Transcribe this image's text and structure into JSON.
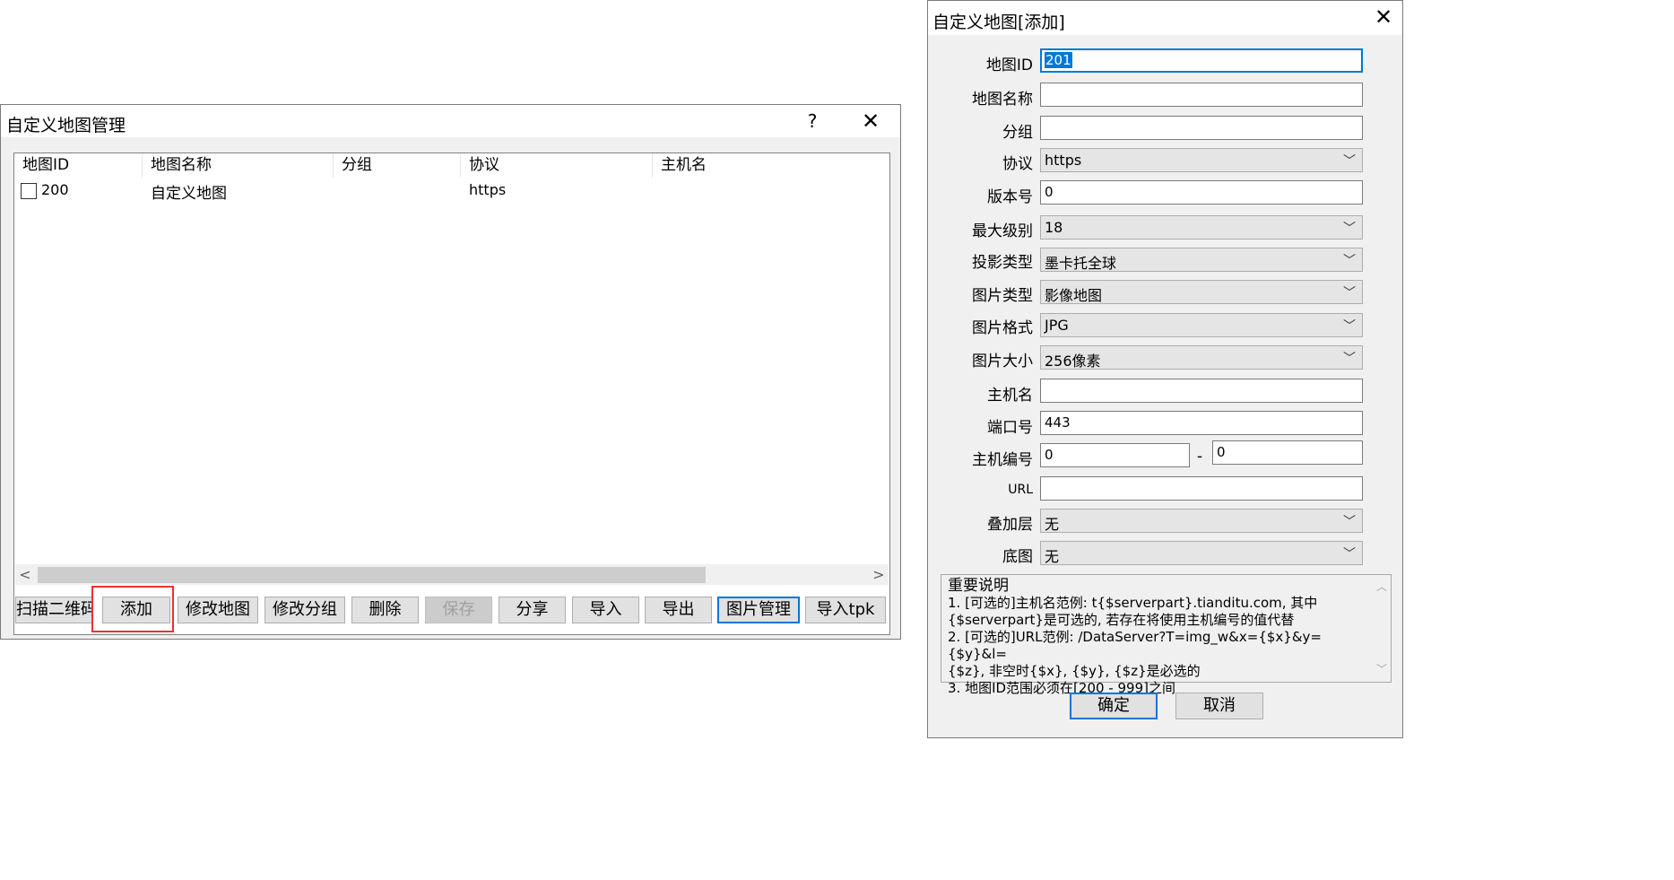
{
  "main_window": {
    "title": "自定义地图管理",
    "help_label": "?",
    "close_label": "✕",
    "columns": [
      "地图ID",
      "地图名称",
      "分组",
      "协议",
      "主机名"
    ],
    "rows": [
      {
        "id": "200",
        "name": "自定义地图",
        "group": "",
        "protocol": "https",
        "host": "",
        "checked": false
      }
    ],
    "scroll_left": "<",
    "scroll_right": ">",
    "buttons": {
      "scan_qr": "扫描二维码",
      "add": "添加",
      "edit_map": "修改地图",
      "edit_group": "修改分组",
      "delete": "删除",
      "save": "保存",
      "share": "分享",
      "import": "导入",
      "export": "导出",
      "image_manage": "图片管理",
      "import_tpk": "导入tpk"
    },
    "highlight_color": "#e8332f"
  },
  "add_dialog": {
    "title": "自定义地图[添加]",
    "close_label": "✕",
    "fields": {
      "map_id": {
        "label": "地图ID",
        "value": "201"
      },
      "map_name": {
        "label": "地图名称",
        "value": ""
      },
      "group": {
        "label": "分组",
        "value": ""
      },
      "protocol": {
        "label": "协议",
        "value": "https"
      },
      "version": {
        "label": "版本号",
        "value": "0"
      },
      "max_level": {
        "label": "最大级别",
        "value": "18"
      },
      "projection": {
        "label": "投影类型",
        "value": "墨卡托全球"
      },
      "image_type": {
        "label": "图片类型",
        "value": "影像地图"
      },
      "image_format": {
        "label": "图片格式",
        "value": "JPG"
      },
      "image_size": {
        "label": "图片大小",
        "value": "256像素"
      },
      "host": {
        "label": "主机名",
        "value": ""
      },
      "port": {
        "label": "端口号",
        "value": "443"
      },
      "host_number": {
        "label": "主机编号",
        "value_from": "0",
        "value_to": "0",
        "separator": "-"
      },
      "url": {
        "label": "URL",
        "value": ""
      },
      "overlay": {
        "label": "叠加层",
        "value": "无"
      },
      "base_map": {
        "label": "底图",
        "value": "无"
      }
    },
    "notes": [
      "重要说明",
      "1. [可选的]主机名范例: t{$serverpart}.tianditu.com, 其中",
      "{$serverpart}是可选的, 若存在将使用主机编号的值代替",
      "2. [可选的]URL范例: /DataServer?T=img_w&x={$x}&y={$y}&l=",
      "{$z}, 非空时{$x}, {$y}, {$z}是必选的",
      "3. 地图ID范围必须在[200 - 999]之间"
    ],
    "ok_label": "确定",
    "cancel_label": "取消",
    "accent_color": "#0078d7"
  }
}
